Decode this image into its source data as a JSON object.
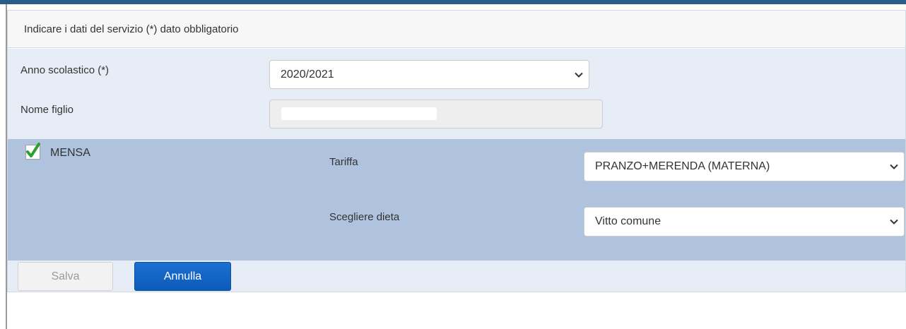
{
  "header": {
    "title": "Indicare i dati del servizio (*) dato obbligatorio"
  },
  "form": {
    "anno_label": "Anno scolastico (*)",
    "anno_value": "2020/2021",
    "nome_label": "Nome figlio",
    "nome_value": ""
  },
  "service": {
    "name": "MENSA",
    "checked": true,
    "tariffa_label": "Tariffa",
    "tariffa_value": "PRANZO+MERENDA (MATERNA)",
    "dieta_label": "Scegliere dieta",
    "dieta_value": "Vitto comune"
  },
  "actions": {
    "save_label": "Salva",
    "cancel_label": "Annulla"
  },
  "icons": {
    "check": "check-icon",
    "chevron": "chevron-down-icon"
  },
  "colors": {
    "accent": "#0d5bb8",
    "band": "#b0c3de",
    "body": "#e6edf7",
    "check": "#2e9e2e"
  }
}
